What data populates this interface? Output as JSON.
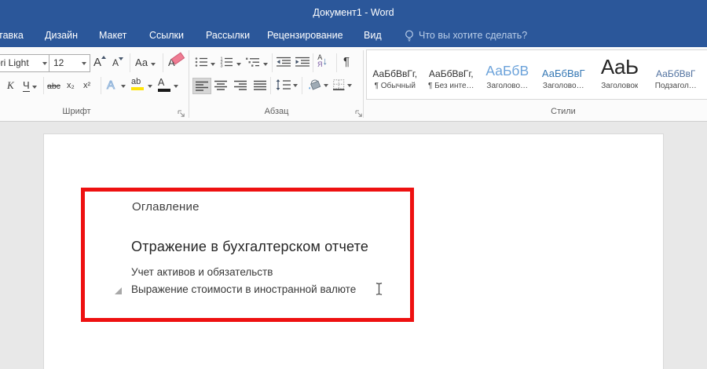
{
  "window": {
    "title": "Документ1 - Word"
  },
  "tabs": {
    "partial": "тавка",
    "items": [
      "Дизайн",
      "Макет",
      "Ссылки",
      "Рассылки",
      "Рецензирование",
      "Вид"
    ],
    "tell_me": "Что вы хотите сделать?"
  },
  "ribbon": {
    "font_group": {
      "label": "Шрифт",
      "font_name": "bri Light",
      "font_size": "12",
      "grow": "А",
      "shrink": "А",
      "case_btn": "Аа",
      "clear": "А",
      "italic": "К",
      "underline": "Ч",
      "strike": "abc",
      "sub": "х₂",
      "sup": "х²",
      "effects": "А",
      "highlight": "ab",
      "color_btn": "А"
    },
    "paragraph_group": {
      "label": "Абзац",
      "sort_a": "А",
      "sort_z": "Я",
      "sort_arrow": "↓",
      "pilcrow": "¶"
    },
    "styles_group": {
      "label": "Стили",
      "items": [
        {
          "sample": "АаБбВвГг,",
          "label": "¶ Обычный",
          "color": "#2f2f2f"
        },
        {
          "sample": "АаБбВвГг,",
          "label": "¶ Без инте…",
          "color": "#2f2f2f"
        },
        {
          "sample": "АаБбВ",
          "label": "Заголово…",
          "color": "#6ba2da"
        },
        {
          "sample": "АаБбВвГ",
          "label": "Заголово…",
          "color": "#3477b4"
        },
        {
          "sample": "АаЬ",
          "label": "Заголовок",
          "color": "#262626"
        },
        {
          "sample": "АаБбВвГ",
          "label": "Подзагол…",
          "color": "#50719f"
        }
      ]
    }
  },
  "document": {
    "toc_heading": "Оглавление",
    "heading": "Отражение в бухгалтерском отчете",
    "body_line1": "Учет активов и обязательств",
    "body_line2": "Выражение стоимости в иностранной валюте"
  },
  "colors": {
    "title_bar": "#2b579a",
    "annotation_box": "#ee1111",
    "document_bg": "#e8e8e8"
  }
}
